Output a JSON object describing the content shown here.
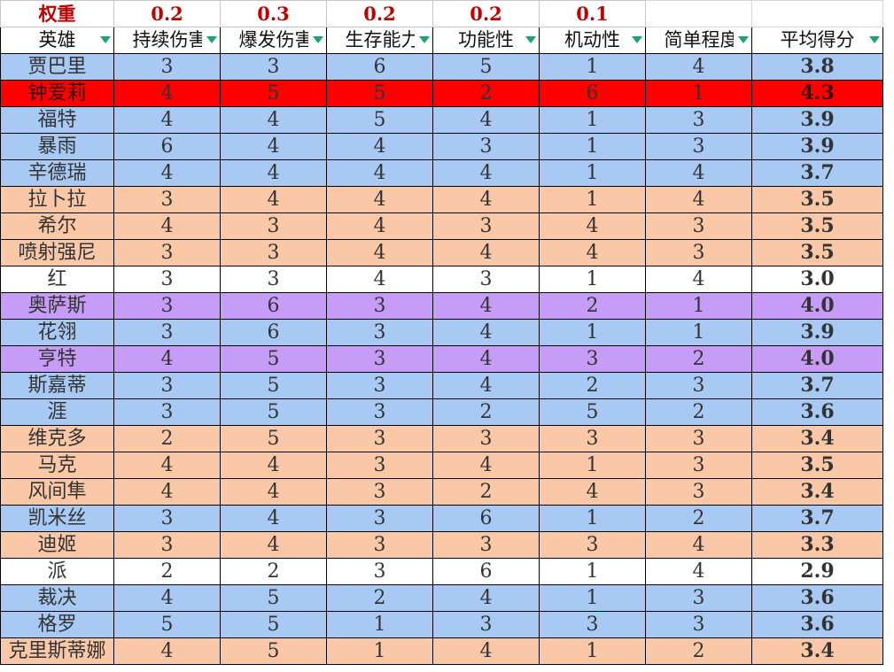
{
  "weights_label": "权重",
  "weights": [
    "0.2",
    "0.3",
    "0.2",
    "0.2",
    "0.1"
  ],
  "headers": [
    {
      "label": "英雄",
      "key": "hero"
    },
    {
      "label": "持续伤害",
      "key": "sustained_damage"
    },
    {
      "label": "爆发伤害",
      "key": "burst_damage"
    },
    {
      "label": "生存能力",
      "key": "survivability"
    },
    {
      "label": "功能性",
      "key": "utility"
    },
    {
      "label": "机动性",
      "key": "mobility"
    },
    {
      "label": "简单程度",
      "key": "ease"
    },
    {
      "label": "平均得分",
      "key": "avg_score"
    }
  ],
  "rows": [
    {
      "name": "贾巴里",
      "vals": [
        "3",
        "3",
        "6",
        "5",
        "1",
        "4"
      ],
      "avg": "3.8",
      "color": "blue",
      "hl": [
        2
      ]
    },
    {
      "name": "钟爱莉",
      "vals": [
        "4",
        "5",
        "5",
        "2",
        "6",
        "1"
      ],
      "avg": "4.3",
      "color": "red",
      "hl": []
    },
    {
      "name": "福特",
      "vals": [
        "4",
        "4",
        "5",
        "4",
        "1",
        "3"
      ],
      "avg": "3.9",
      "color": "blue",
      "hl": []
    },
    {
      "name": "暴雨",
      "vals": [
        "6",
        "4",
        "4",
        "3",
        "1",
        "3"
      ],
      "avg": "3.9",
      "color": "blue",
      "hl": [
        0
      ]
    },
    {
      "name": "辛德瑞",
      "vals": [
        "4",
        "4",
        "4",
        "4",
        "1",
        "4"
      ],
      "avg": "3.7",
      "color": "blue",
      "hl": []
    },
    {
      "name": "拉卜拉",
      "vals": [
        "3",
        "4",
        "4",
        "4",
        "1",
        "4"
      ],
      "avg": "3.5",
      "color": "peach",
      "hl": []
    },
    {
      "name": "希尔",
      "vals": [
        "4",
        "3",
        "4",
        "3",
        "4",
        "3"
      ],
      "avg": "3.5",
      "color": "peach",
      "hl": []
    },
    {
      "name": "喷射强尼",
      "vals": [
        "3",
        "3",
        "4",
        "4",
        "4",
        "3"
      ],
      "avg": "3.5",
      "color": "peach",
      "hl": []
    },
    {
      "name": "红",
      "vals": [
        "3",
        "3",
        "4",
        "3",
        "1",
        "4"
      ],
      "avg": "3.0",
      "color": "white",
      "hl": []
    },
    {
      "name": "奥萨斯",
      "vals": [
        "3",
        "6",
        "3",
        "4",
        "2",
        "1"
      ],
      "avg": "4.0",
      "color": "purple",
      "hl": [
        1
      ]
    },
    {
      "name": "花翎",
      "vals": [
        "3",
        "6",
        "3",
        "4",
        "1",
        "1"
      ],
      "avg": "3.9",
      "color": "blue",
      "hl": [
        1
      ]
    },
    {
      "name": "亨特",
      "vals": [
        "4",
        "5",
        "3",
        "4",
        "3",
        "2"
      ],
      "avg": "4.0",
      "color": "purple",
      "hl": []
    },
    {
      "name": "斯嘉蒂",
      "vals": [
        "3",
        "5",
        "3",
        "4",
        "2",
        "3"
      ],
      "avg": "3.7",
      "color": "blue",
      "hl": []
    },
    {
      "name": "涯",
      "vals": [
        "3",
        "5",
        "3",
        "2",
        "5",
        "2"
      ],
      "avg": "3.6",
      "color": "blue",
      "hl": []
    },
    {
      "name": "维克多",
      "vals": [
        "2",
        "5",
        "3",
        "3",
        "3",
        "3"
      ],
      "avg": "3.4",
      "color": "peach",
      "hl": []
    },
    {
      "name": "马克",
      "vals": [
        "4",
        "4",
        "3",
        "4",
        "1",
        "3"
      ],
      "avg": "3.5",
      "color": "peach",
      "hl": []
    },
    {
      "name": "风间隼",
      "vals": [
        "4",
        "4",
        "3",
        "2",
        "4",
        "3"
      ],
      "avg": "3.4",
      "color": "peach",
      "hl": []
    },
    {
      "name": "凯米丝",
      "vals": [
        "3",
        "4",
        "3",
        "6",
        "1",
        "2"
      ],
      "avg": "3.7",
      "color": "blue",
      "hl": [
        3
      ]
    },
    {
      "name": "迪姬",
      "vals": [
        "3",
        "4",
        "3",
        "3",
        "3",
        "4"
      ],
      "avg": "3.3",
      "color": "peach",
      "hl": []
    },
    {
      "name": "派",
      "vals": [
        "2",
        "2",
        "3",
        "6",
        "1",
        "4"
      ],
      "avg": "2.9",
      "color": "white",
      "hl": [
        3
      ]
    },
    {
      "name": "裁决",
      "vals": [
        "4",
        "5",
        "2",
        "4",
        "1",
        "3"
      ],
      "avg": "3.6",
      "color": "blue",
      "hl": []
    },
    {
      "name": "格罗",
      "vals": [
        "5",
        "5",
        "1",
        "3",
        "3",
        "3"
      ],
      "avg": "3.6",
      "color": "blue",
      "hl": []
    },
    {
      "name": "克里斯蒂娜",
      "vals": [
        "4",
        "5",
        "1",
        "4",
        "1",
        "2"
      ],
      "avg": "3.4",
      "color": "peach",
      "hl": []
    }
  ],
  "colors": {
    "blue": "#a8c9f4",
    "red": "#ff0000",
    "peach": "#fac8a6",
    "white": "#ffffff",
    "purple": "#c79cf6",
    "weight_text": "#c00000",
    "filter_icon": "#18a66a"
  },
  "icons": {
    "filter": "filter-dropdown-icon"
  }
}
